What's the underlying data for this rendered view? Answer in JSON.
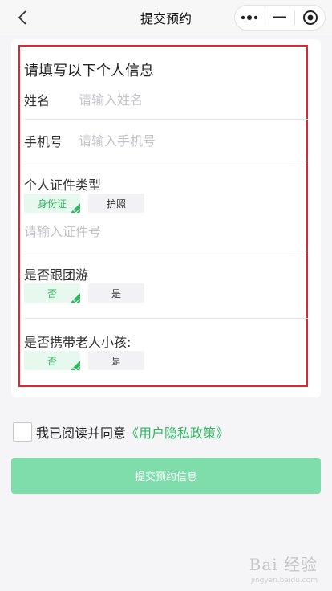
{
  "navbar": {
    "title": "提交预约",
    "back_icon": "chevron-left-icon",
    "capsule": {
      "more_icon": "more-dots-icon",
      "minimize_icon": "minimize-icon",
      "close_icon": "target-circle-icon"
    }
  },
  "form": {
    "section_title": "请填写以下个人信息",
    "name": {
      "label": "姓名",
      "placeholder": "请输入姓名",
      "value": ""
    },
    "phone": {
      "label": "手机号",
      "placeholder": "请输入手机号",
      "value": ""
    },
    "id_type": {
      "label": "个人证件类型",
      "options": [
        "身份证",
        "护照"
      ],
      "selected": "身份证",
      "number_placeholder": "请输入证件号"
    },
    "group_tour": {
      "label": "是否跟团游",
      "options": [
        "否",
        "是"
      ],
      "selected": "否"
    },
    "with_elder_child": {
      "label": "是否携带老人小孩:",
      "options": [
        "否",
        "是"
      ],
      "selected": "否"
    }
  },
  "agreement": {
    "checked": false,
    "text": "我已阅读并同意",
    "link": "《用户隐私政策》"
  },
  "submit": {
    "label": "提交预约信息"
  },
  "watermark": {
    "main": "Bai 经验",
    "sub": "jingyan.baidu.com"
  },
  "colors": {
    "accent": "#2db860",
    "button": "#7fdcab",
    "highlight": "#e3232d",
    "background": "#f5f5f7"
  }
}
